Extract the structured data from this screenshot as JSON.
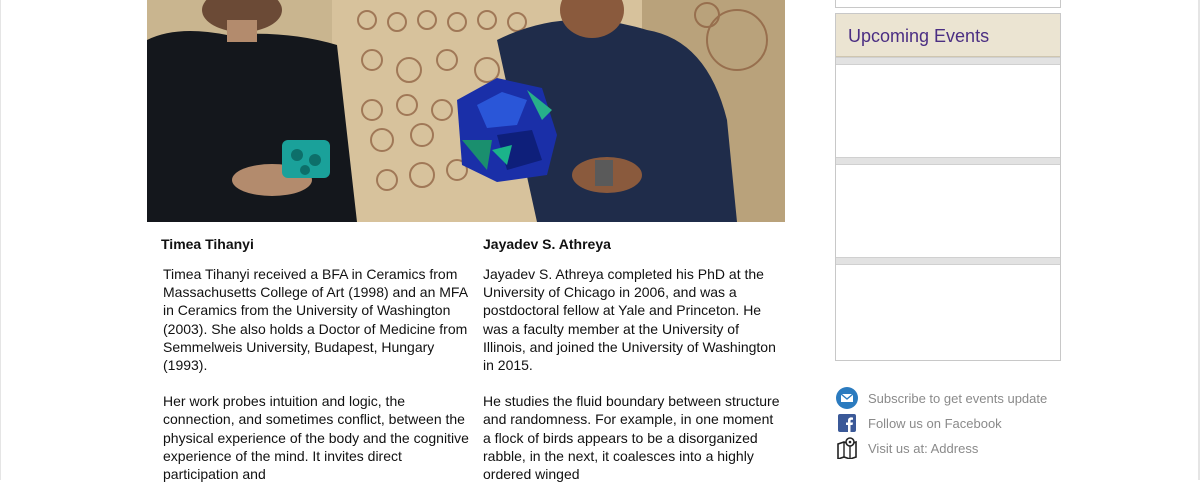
{
  "people": [
    {
      "name": "Timea Tihanyi",
      "paragraphs": [
        "Timea Tihanyi received a BFA in Ceramics from Massachusetts College of Art (1998) and an MFA in Ceramics from the University of Washington (2003). She also holds a Doctor of Medicine from Semmelweis University, Budapest, Hungary (1993).",
        "Her work probes intuition and logic, the connection, and sometimes conflict, between the physical experience of the body and the cognitive experience of the mind. It invites direct participation and"
      ]
    },
    {
      "name": "Jayadev S. Athreya",
      "paragraphs": [
        "Jayadev S. Athreya completed his PhD at the University of Chicago in 2006, and was a postdoctoral fellow at Yale and Princeton. He was a faculty member at the University of Illinois, and joined the University of Washington in 2015.",
        "He studies the fluid boundary between structure and randomness. For example, in one moment a flock of birds appears to be a disorganized rabble, in the next, it coalesces into a highly ordered winged"
      ]
    }
  ],
  "sidebar": {
    "events_title": "Upcoming Events",
    "links": [
      {
        "label": "Subscribe to get events update",
        "icon": "email-icon"
      },
      {
        "label": "Follow us on Facebook",
        "icon": "facebook-icon"
      },
      {
        "label": "Visit us at: Address",
        "icon": "map-icon"
      }
    ]
  },
  "colors": {
    "accent_purple": "#4b2e83",
    "header_bg": "#ebe4d2",
    "facebook_blue": "#3b5998",
    "email_blue": "#2b7bbf"
  }
}
